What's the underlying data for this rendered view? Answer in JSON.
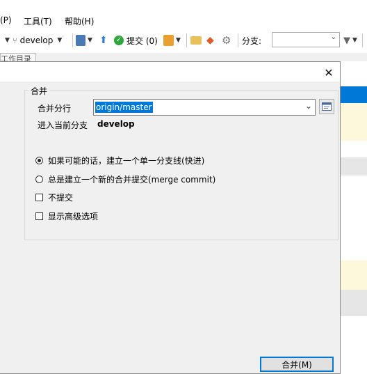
{
  "menu": {
    "items": [
      "(P)",
      "工具(T)",
      "帮助(H)"
    ]
  },
  "toolbar": {
    "branch_name": "develop",
    "commit_label": "提交 (0)",
    "branch_filter_label": "分支:"
  },
  "background": {
    "tab_label": "工作目录"
  },
  "dialog": {
    "group_title": "合并",
    "merge_branch_label": "合并分行",
    "merge_branch_value": "origin/master",
    "into_branch_label": "进入当前分支",
    "into_branch_value": "develop",
    "options": [
      {
        "type": "radio",
        "label": "如果可能的话，建立一个单一分支线(快进)",
        "checked": true
      },
      {
        "type": "radio",
        "label": "总是建立一个新的合并提交(merge commit)",
        "checked": false
      },
      {
        "type": "checkbox",
        "label": "不提交",
        "checked": false
      },
      {
        "type": "checkbox",
        "label": "显示高级选项",
        "checked": false
      }
    ],
    "merge_button_label": "合并(M)"
  },
  "colors": {
    "selection": "#0078d7",
    "focus_border": "#0078d7",
    "row_blue": "#0078d7",
    "row_yellow": "#fdf8dc",
    "row_gray": "#e6e6e6"
  }
}
